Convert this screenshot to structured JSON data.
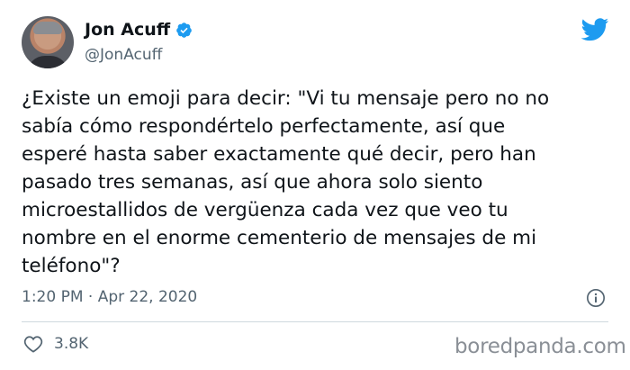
{
  "author": {
    "name": "Jon Acuff",
    "handle": "@JonAcuff",
    "verified_icon": "verified-badge-icon"
  },
  "tweet": {
    "text": "¿Existe un emoji para decir: \"Vi tu mensaje pero no no\nsabía cómo respondértelo perfectamente, así que\nesperé hasta saber exactamente qué decir, pero han\npasado tres semanas, así que ahora solo siento\nmicroestallidos de vergüenza cada vez que veo tu\nnombre en el enorme cementerio de mensajes de mi\nteléfono\"?",
    "timestamp": "1:20 PM · Apr 22, 2020",
    "likes": "3.8K"
  },
  "watermark": "boredpanda.com",
  "colors": {
    "twitter_blue": "#1d9bf0",
    "text": "#0f1419",
    "secondary": "#536471"
  }
}
